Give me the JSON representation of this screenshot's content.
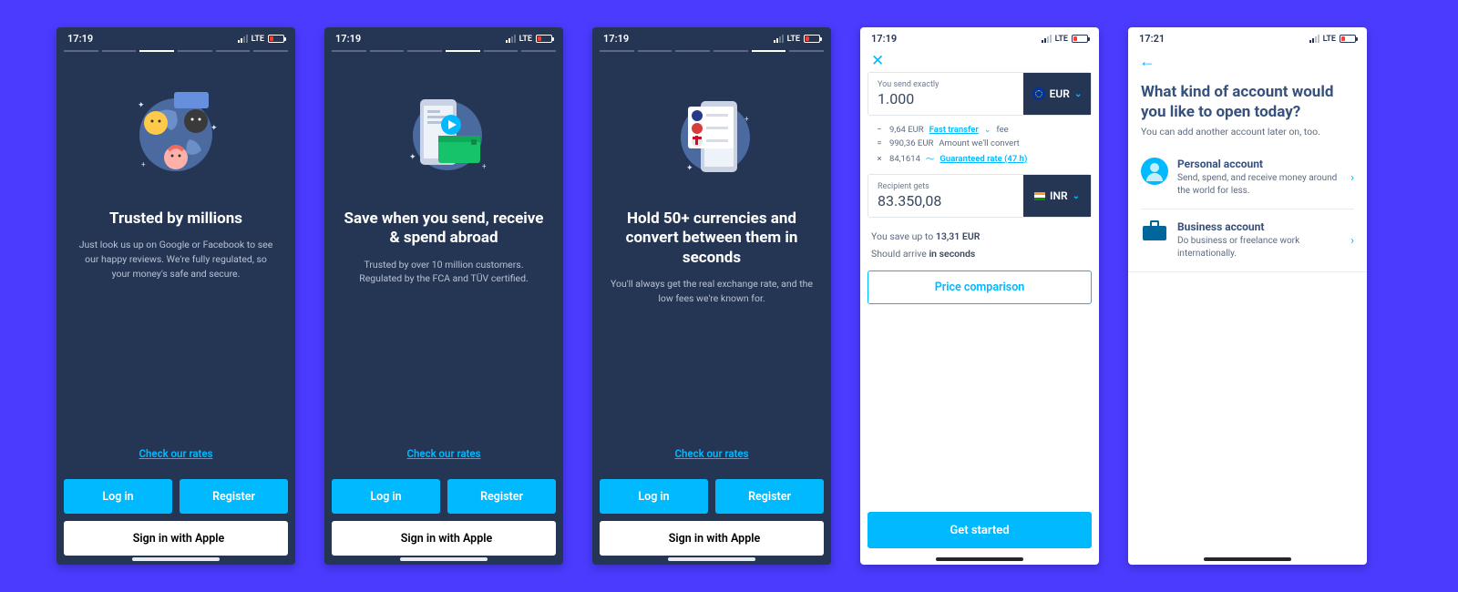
{
  "onboarding": {
    "status_time": "17:19",
    "network": "LTE",
    "rates_link": "Check our rates",
    "login_label": "Log in",
    "register_label": "Register",
    "apple_label": "Sign in with Apple",
    "slides": [
      {
        "title": "Trusted by millions",
        "subtitle": "Just look us up on Google or Facebook to see our happy reviews. We're fully regulated, so your money's safe and secure."
      },
      {
        "title": "Save when you send, receive & spend abroad",
        "subtitle": "Trusted by over 10 million customers. Regulated by the FCA and TÜV certified."
      },
      {
        "title": "Hold 50+ currencies and convert between them in seconds",
        "subtitle": "You'll always get the real exchange rate, and the low fees we're known for."
      }
    ]
  },
  "calculator": {
    "status_time": "17:19",
    "network": "LTE",
    "send_label": "You send exactly",
    "send_amount": "1.000",
    "send_currency": "EUR",
    "fees": [
      {
        "symbol": "−",
        "value": "9,64 EUR",
        "link": "Fast transfer",
        "suffix": "fee"
      },
      {
        "symbol": "=",
        "value": "990,36 EUR",
        "suffix": "Amount we'll convert"
      },
      {
        "symbol": "×",
        "value": "84,1614",
        "link": "Guaranteed rate (47 h)"
      }
    ],
    "recv_label": "Recipient gets",
    "recv_amount": "83.350,08",
    "recv_currency": "INR",
    "save_pre": "You save up to ",
    "save_amt": "13,31 EUR",
    "arrive_pre": "Should arrive ",
    "arrive_bold": "in seconds",
    "price_compare": "Price comparison",
    "cta": "Get started"
  },
  "account_type": {
    "status_time": "17:21",
    "network": "LTE",
    "title": "What kind of account would you like to open today?",
    "subtitle": "You can add another account later on, too.",
    "personal": {
      "name": "Personal account",
      "desc": "Send, spend, and receive money around the world for less."
    },
    "business": {
      "name": "Business account",
      "desc": "Do business or freelance work internationally."
    }
  }
}
